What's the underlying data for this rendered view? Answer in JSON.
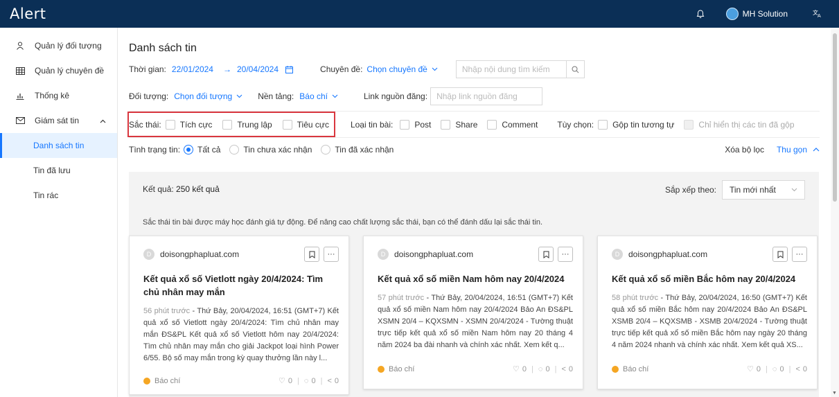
{
  "app": {
    "logo": "Alert",
    "user_name": "MH Solution",
    "lang_icon": "translate-icon"
  },
  "sidebar": {
    "items": [
      {
        "label": "Quản lý đối tượng",
        "icon": "user-icon"
      },
      {
        "label": "Quản lý chuyên đề",
        "icon": "table-icon"
      },
      {
        "label": "Thống kê",
        "icon": "chart-icon"
      },
      {
        "label": "Giám sát tin",
        "icon": "mail-icon"
      }
    ],
    "subitems": [
      {
        "label": "Danh sách tin",
        "active": true
      },
      {
        "label": "Tin đã lưu"
      },
      {
        "label": "Tin rác"
      }
    ]
  },
  "page": {
    "title": "Danh sách tin"
  },
  "filters": {
    "time_label": "Thời gian:",
    "date_from": "22/01/2024",
    "arrow": "→",
    "date_to": "20/04/2024",
    "topic_label": "Chuyên đề:",
    "topic_value": "Chọn chuyên đề",
    "search_placeholder": "Nhập nội dung tìm kiếm",
    "object_label": "Đối tượng:",
    "object_value": "Chọn đối tượng",
    "platform_label": "Nền tảng:",
    "platform_value": "Báo chí",
    "link_label": "Link nguồn đăng:",
    "link_placeholder": "Nhập link nguồn đăng",
    "sentiment_label": "Sắc thái:",
    "sentiment_options": [
      "Tích cực",
      "Trung lập",
      "Tiêu cực"
    ],
    "type_label": "Loại tin bài:",
    "type_options": [
      "Post",
      "Share",
      "Comment"
    ],
    "option_label": "Tùy chọn:",
    "merge_label": "Gộp tin tương tự",
    "merged_only_label": "Chỉ hiển thị các tin đã gộp",
    "status_label": "Tình trạng tin:",
    "status_options": [
      "Tất cả",
      "Tin chưa xác nhận",
      "Tin đã xác nhận"
    ],
    "status_selected": "Tất cả",
    "clear_label": "Xóa bộ lọc",
    "collapse_label": "Thu gọn"
  },
  "results": {
    "prefix": "Kết quả:",
    "count_text": "250 kết quả",
    "sort_label": "Sắp xếp theo:",
    "sort_value": "Tin mới nhất",
    "note": "Sắc thái tin bài được máy học đánh giá tự động. Để nâng cao chất lượng sắc thái, bạn có thể đánh dấu lại sắc thái tin."
  },
  "cards": [
    {
      "avatar": "D",
      "source": "doisongphapluat.com",
      "title": "Kết quả xổ số Vietlott ngày 20/4/2024: Tìm chủ nhân may mắn",
      "time": "56 phút trước",
      "desc": " - Thứ Bảy, 20/04/2024, 16:51 (GMT+7) Kết quả xổ số Vietlott ngày 20/4/2024: Tìm chủ nhân may mắn ĐS&PL Kết quả xổ số Vietlott hôm nay 20/4/2024: Tìm chủ nhân may mắn cho giải Jackpot loại hình Power 6/55. Bộ số may mắn trong kỳ quay thưởng lần này l...",
      "category": "Báo chí",
      "likes": "0",
      "comments": "0",
      "shares": "0"
    },
    {
      "avatar": "D",
      "source": "doisongphapluat.com",
      "title": "Kết quả xổ số miền Nam hôm nay 20/4/2024",
      "time": "57 phút trước",
      "desc": " - Thứ Bảy, 20/04/2024, 16:51 (GMT+7) Kết quả xổ số miền Nam hôm nay 20/4/2024 Bảo An ĐS&PL XSMN 20/4 – KQXSMN - XSMN 20/4/2024 - Tường thuật trực tiếp kết quả xổ số miền Nam hôm nay 20 tháng 4 năm 2024 ba đài nhanh và chính xác nhất. Xem kết q...",
      "category": "Báo chí",
      "likes": "0",
      "comments": "0",
      "shares": "0"
    },
    {
      "avatar": "D",
      "source": "doisongphapluat.com",
      "title": "Kết quả xổ số miền Bắc hôm nay 20/4/2024",
      "time": "58 phút trước",
      "desc": " - Thứ Bảy, 20/04/2024, 16:50 (GMT+7) Kết quả xổ số miền Bắc hôm nay 20/4/2024 Bảo An ĐS&PL XSMB 20/4 – KQXSMB - XSMB 20/4/2024 - Tường thuật trực tiếp kết quả xổ số miền Bắc hôm nay ngày 20 tháng 4 năm 2024 nhanh và chính xác nhất. Xem kết quả XS...",
      "category": "Báo chí",
      "likes": "0",
      "comments": "0",
      "shares": "0"
    }
  ]
}
